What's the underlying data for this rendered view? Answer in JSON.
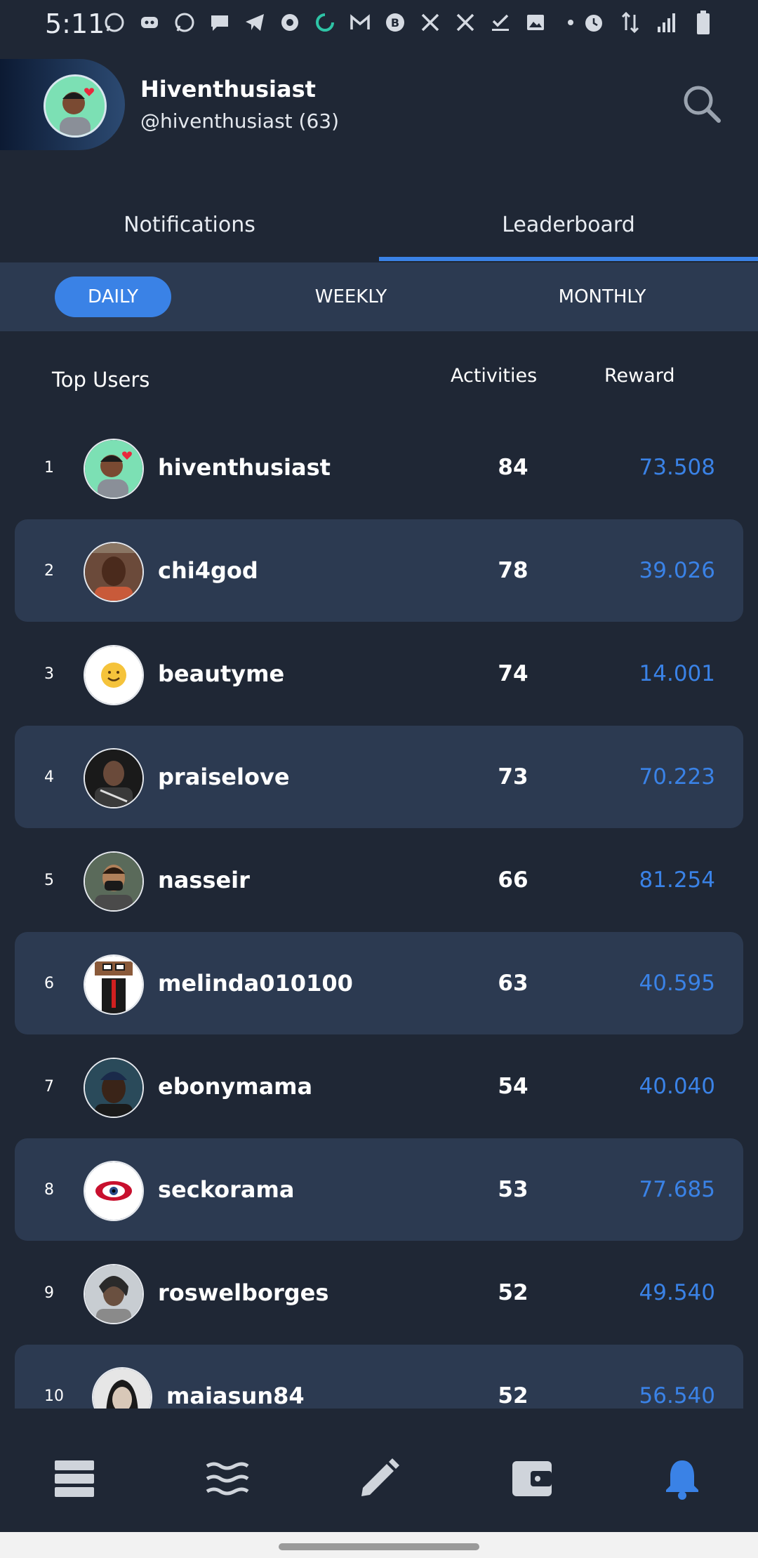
{
  "status_bar": {
    "time": "5:11"
  },
  "header": {
    "display_name": "Hiventhusiast",
    "handle": "@hiventhusiast (63)"
  },
  "tabs": [
    {
      "label": "Notifications",
      "active": false
    },
    {
      "label": "Leaderboard",
      "active": true
    }
  ],
  "periods": [
    {
      "label": "DAILY",
      "active": true
    },
    {
      "label": "WEEKLY",
      "active": false
    },
    {
      "label": "MONTHLY",
      "active": false
    }
  ],
  "table": {
    "title": "Top Users",
    "col_activities": "Activities",
    "col_reward": "Reward"
  },
  "leaderboard": [
    {
      "rank": "1",
      "username": "hiventhusiast",
      "activities": "84",
      "reward": "73.508"
    },
    {
      "rank": "2",
      "username": "chi4god",
      "activities": "78",
      "reward": "39.026"
    },
    {
      "rank": "3",
      "username": "beautyme",
      "activities": "74",
      "reward": "14.001"
    },
    {
      "rank": "4",
      "username": "praiselove",
      "activities": "73",
      "reward": "70.223"
    },
    {
      "rank": "5",
      "username": "nasseir",
      "activities": "66",
      "reward": "81.254"
    },
    {
      "rank": "6",
      "username": "melinda010100",
      "activities": "63",
      "reward": "40.595"
    },
    {
      "rank": "7",
      "username": "ebonymama",
      "activities": "54",
      "reward": "40.040"
    },
    {
      "rank": "8",
      "username": "seckorama",
      "activities": "53",
      "reward": "77.685"
    },
    {
      "rank": "9",
      "username": "roswelborges",
      "activities": "52",
      "reward": "49.540"
    },
    {
      "rank": "10",
      "username": "maiasun84",
      "activities": "52",
      "reward": "56.540"
    }
  ],
  "colors": {
    "background": "#1f2735",
    "row_alt": "#2c3a51",
    "accent": "#3a82e6"
  },
  "bottom_nav": [
    "feed-icon",
    "waves-icon",
    "pencil-icon",
    "wallet-icon",
    "bell-icon"
  ]
}
